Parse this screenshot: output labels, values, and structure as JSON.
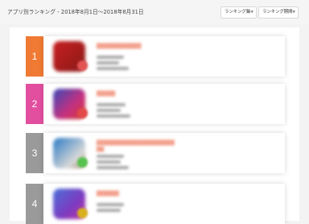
{
  "header": {
    "title": "アプリ別ランキング - 2018年8月1日～2018年8月31日",
    "axis_dropdown": "ランキング軸",
    "period_dropdown": "ランキング期間"
  },
  "rankings": [
    {
      "rank": "1",
      "color": "#f07a33",
      "icon_colors": [
        "#c81f1f",
        "#8a1a1a"
      ],
      "badge_color": "#e25454"
    },
    {
      "rank": "2",
      "color": "#e24f9f",
      "icon_colors": [
        "#c7307e",
        "#3a49b8"
      ],
      "badge_color": "#e24a4a"
    },
    {
      "rank": "3",
      "color": "#9a9a9a",
      "icon_colors": [
        "#2b7bc4",
        "#d8d8d8"
      ],
      "badge_color": "#58c24f"
    },
    {
      "rank": "4",
      "color": "#9a9a9a",
      "icon_colors": [
        "#4a6fd8",
        "#7e3ac0"
      ],
      "badge_color": "#d7b21e"
    }
  ],
  "icons": {
    "axis_chevron": "chevron-down-icon",
    "period_chevron": "chevron-down-icon"
  }
}
